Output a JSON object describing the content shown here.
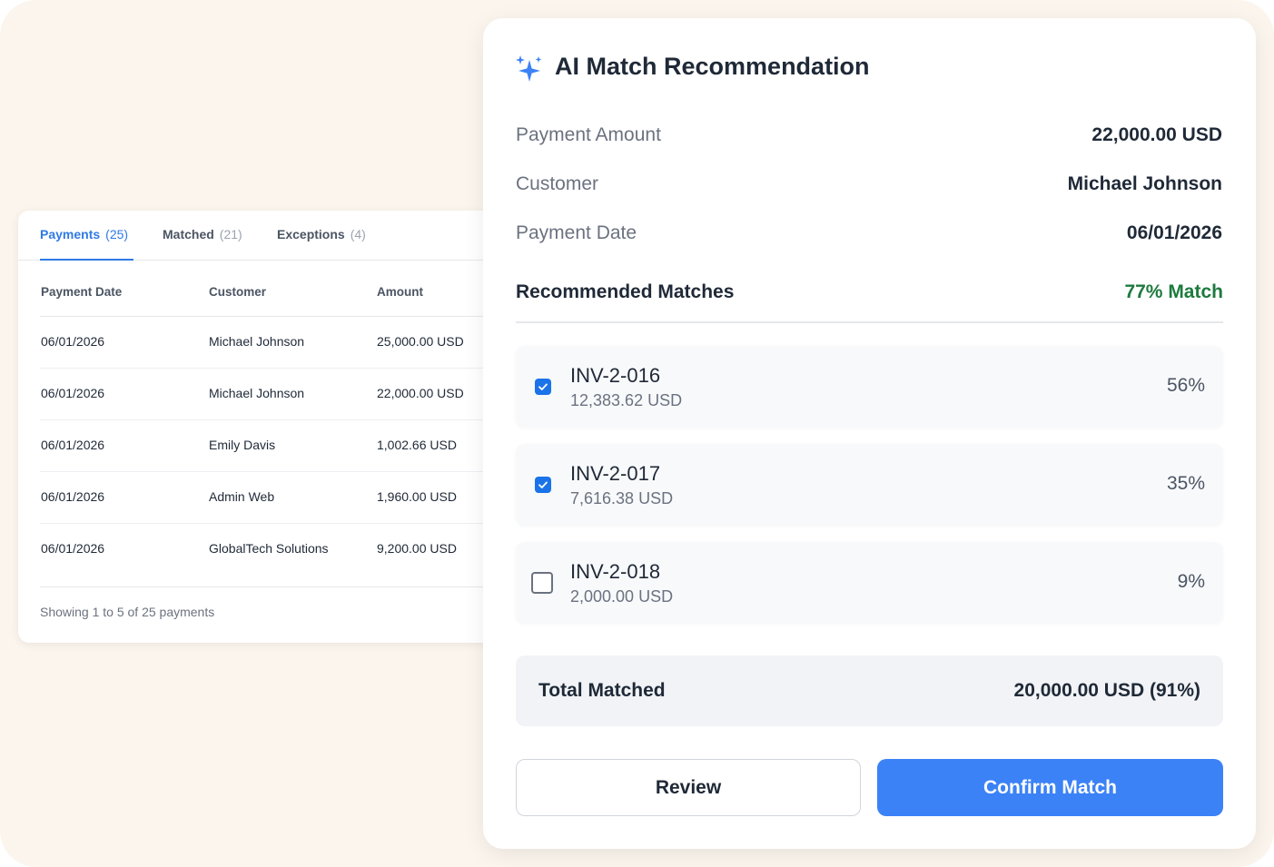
{
  "payments_table": {
    "tabs": [
      {
        "label": "Payments",
        "count": "(25)"
      },
      {
        "label": "Matched",
        "count": "(21)"
      },
      {
        "label": "Exceptions",
        "count": "(4)"
      }
    ],
    "columns": [
      "Payment Date",
      "Customer",
      "Amount"
    ],
    "rows": [
      {
        "date": "06/01/2026",
        "customer": "Michael Johnson",
        "amount": "25,000.00 USD"
      },
      {
        "date": "06/01/2026",
        "customer": "Michael Johnson",
        "amount": "22,000.00 USD"
      },
      {
        "date": "06/01/2026",
        "customer": "Emily Davis",
        "amount": "1,002.66 USD"
      },
      {
        "date": "06/01/2026",
        "customer": "Admin Web",
        "amount": "1,960.00 USD"
      },
      {
        "date": "06/01/2026",
        "customer": "GlobalTech Solutions",
        "amount": "9,200.00 USD"
      }
    ],
    "footer": "Showing 1 to 5 of 25 payments"
  },
  "recommendation": {
    "title": "AI Match Recommendation",
    "icon": "sparkle-icon",
    "details": [
      {
        "label": "Payment Amount",
        "value": "22,000.00 USD"
      },
      {
        "label": "Customer",
        "value": "Michael Johnson"
      },
      {
        "label": "Payment Date",
        "value": "06/01/2026"
      }
    ],
    "matches_title": "Recommended Matches",
    "match_score": "77% Match",
    "matches": [
      {
        "invoice": "INV-2-016",
        "amount": "12,383.62 USD",
        "percent": "56%",
        "checked": true
      },
      {
        "invoice": "INV-2-017",
        "amount": "7,616.38 USD",
        "percent": "35%",
        "checked": true
      },
      {
        "invoice": "INV-2-018",
        "amount": "2,000.00 USD",
        "percent": "9%",
        "checked": false
      }
    ],
    "total_label": "Total Matched",
    "total_value": "20,000.00 USD (91%)",
    "review_label": "Review",
    "confirm_label": "Confirm Match"
  },
  "colors": {
    "accent": "#3b82f6",
    "active_tab": "#2f7ae5",
    "match_score": "#1d7a3e",
    "background": "#fbf5ee"
  }
}
